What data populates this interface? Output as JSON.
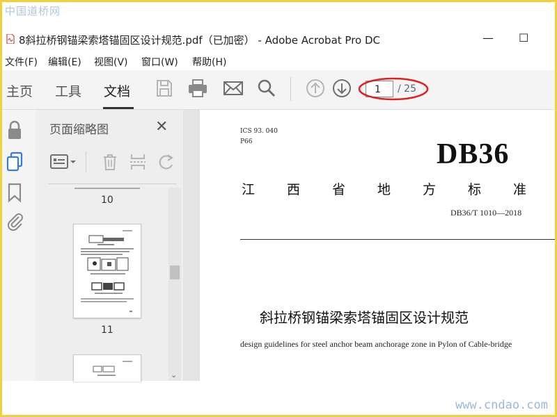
{
  "watermarks": {
    "top": "中国道桥网",
    "bottom": "www.cndao.com"
  },
  "window": {
    "title": "8斜拉桥钢锚梁索塔锚固区设计规范.pdf（已加密） - Adobe Acrobat Pro DC",
    "minimize": "—",
    "maximize": "☐"
  },
  "menu": [
    "文件(F)",
    "编辑(E)",
    "视图(V)",
    "窗口(W)",
    "帮助(H)"
  ],
  "toolbar": {
    "tabs": [
      "主页",
      "工具",
      "文档"
    ],
    "active_tab": "文档",
    "icons": [
      "save-icon",
      "print-icon",
      "email-icon",
      "search-icon",
      "page-up-icon",
      "page-down-icon"
    ],
    "current_page": "1",
    "total_pages": "/ 25"
  },
  "rail_icons": [
    "lock-icon",
    "pages-icon",
    "bookmark-icon",
    "attachment-icon"
  ],
  "thumbnails_panel": {
    "title": "页面缩略图",
    "close": "✕",
    "pages": [
      "10",
      "11"
    ]
  },
  "document": {
    "ics": "ICS 93. 040",
    "ccs": "P66",
    "db_label": "DB36",
    "standard_type": "江西省地方标准",
    "code": "DB36/T 1010—2018",
    "title_cn": "斜拉桥钢锚梁索塔锚固区设计规范",
    "title_en": "design guidelines for steel anchor beam anchorage zone in Pylon of Cable-bridge"
  },
  "colors": {
    "highlight_ellipse": "#e02020",
    "frame": "#f2d23a",
    "icon_blue": "#3a7bd5"
  }
}
